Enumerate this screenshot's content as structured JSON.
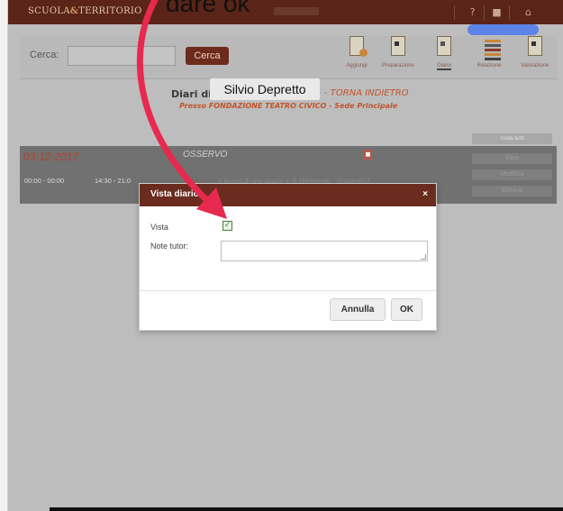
{
  "app": {
    "logo_left": "SCUOLA",
    "logo_amp": "&",
    "logo_right": "TERRITORIO"
  },
  "annotation": {
    "text": "dare ok"
  },
  "search": {
    "label": "Cerca:",
    "value": "",
    "button_label": "Cerca"
  },
  "tabs": [
    {
      "label": "Aggiungi"
    },
    {
      "label": "Preparazione"
    },
    {
      "label": "Diario"
    },
    {
      "label": "Relazione"
    },
    {
      "label": "Valutazione"
    }
  ],
  "header": {
    "title_prefix": "Diari di",
    "student_name": "Silvio Depretto",
    "back_link": "- TORNA INDIETRO",
    "subtitle": "Presso FONDAZIONE TEATRO CIVICO - Sede Principale"
  },
  "list": {
    "view_all_label": "Vista tutti"
  },
  "record": {
    "date": "03-12-2017",
    "type": "OSSERVO",
    "time_slot_1": "00:00 - 00:00",
    "time_slot_2": "14:30 - 21:0",
    "description": "...o lavoro di uno spazio e di riferimento - (espandi/c)",
    "actions": [
      "Vista",
      "Modifica",
      "Elimina"
    ]
  },
  "modal": {
    "title": "Vista diario",
    "close_label": "×",
    "vista_label": "Vista",
    "vista_checked": true,
    "note_label": "Note tutor:",
    "note_value": "",
    "cancel_label": "Annulla",
    "ok_label": "OK"
  },
  "colors": {
    "brand": "#5a2418",
    "accent": "#c0552e",
    "arrow": "#e8294f",
    "highlight": "#5b84e6"
  }
}
